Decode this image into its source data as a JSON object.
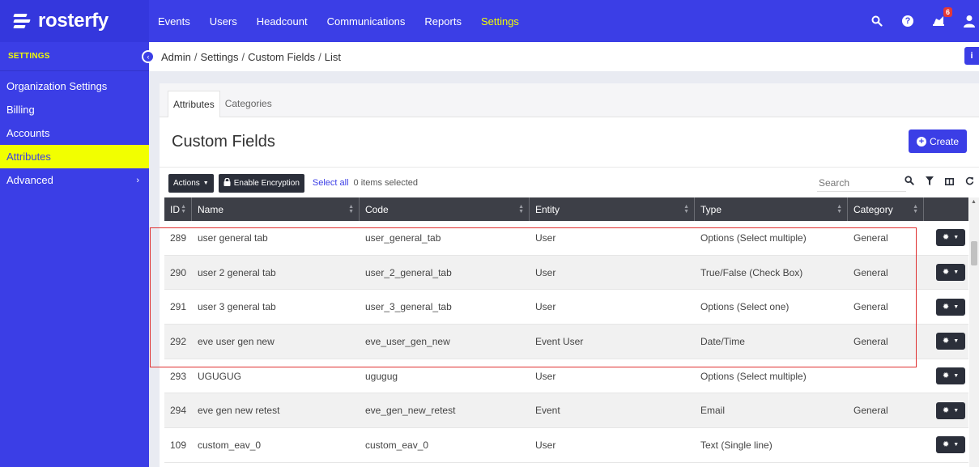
{
  "brand": {
    "name": "rosterfy"
  },
  "topnav": {
    "items": [
      "Events",
      "Users",
      "Headcount",
      "Communications",
      "Reports",
      "Settings"
    ],
    "active": "Settings"
  },
  "notifications": {
    "count": "6"
  },
  "sidebar": {
    "header": "SETTINGS",
    "items": [
      {
        "label": "Organization Settings"
      },
      {
        "label": "Billing"
      },
      {
        "label": "Accounts"
      },
      {
        "label": "Attributes"
      },
      {
        "label": "Advanced"
      }
    ]
  },
  "breadcrumb": [
    "Admin",
    "Settings",
    "Custom Fields",
    "List"
  ],
  "tabs": [
    "Attributes",
    "Categories"
  ],
  "page": {
    "title": "Custom Fields",
    "create_label": "Create"
  },
  "toolbar": {
    "actions_label": "Actions",
    "encrypt_label": "Enable Encryption",
    "select_all_label": "Select all",
    "selected_text": "0 items selected",
    "search_placeholder": "Search"
  },
  "table": {
    "headers": [
      "ID",
      "Name",
      "Code",
      "Entity",
      "Type",
      "Category"
    ],
    "rows": [
      {
        "id": "289",
        "name": "user general tab",
        "code": "user_general_tab",
        "entity": "User",
        "type": "Options (Select multiple)",
        "category": "General"
      },
      {
        "id": "290",
        "name": "user 2 general tab",
        "code": "user_2_general_tab",
        "entity": "User",
        "type": "True/False (Check Box)",
        "category": "General"
      },
      {
        "id": "291",
        "name": "user 3 general tab",
        "code": "user_3_general_tab",
        "entity": "User",
        "type": "Options (Select one)",
        "category": "General"
      },
      {
        "id": "292",
        "name": "eve user gen new",
        "code": "eve_user_gen_new",
        "entity": "Event User",
        "type": "Date/Time",
        "category": "General"
      },
      {
        "id": "293",
        "name": "UGUGUG",
        "code": "ugugug",
        "entity": "User",
        "type": "Options (Select multiple)",
        "category": ""
      },
      {
        "id": "294",
        "name": "eve gen new retest",
        "code": "eve_gen_new_retest",
        "entity": "Event",
        "type": "Email",
        "category": "General"
      },
      {
        "id": "109",
        "name": "custom_eav_0",
        "code": "custom_eav_0",
        "entity": "User",
        "type": "Text (Single line)",
        "category": ""
      }
    ]
  },
  "colors": {
    "brand_blue": "#3b3ee6",
    "highlight_yellow": "#f2ff00",
    "annotation_red": "#e03131",
    "table_header": "#3d3f47"
  }
}
